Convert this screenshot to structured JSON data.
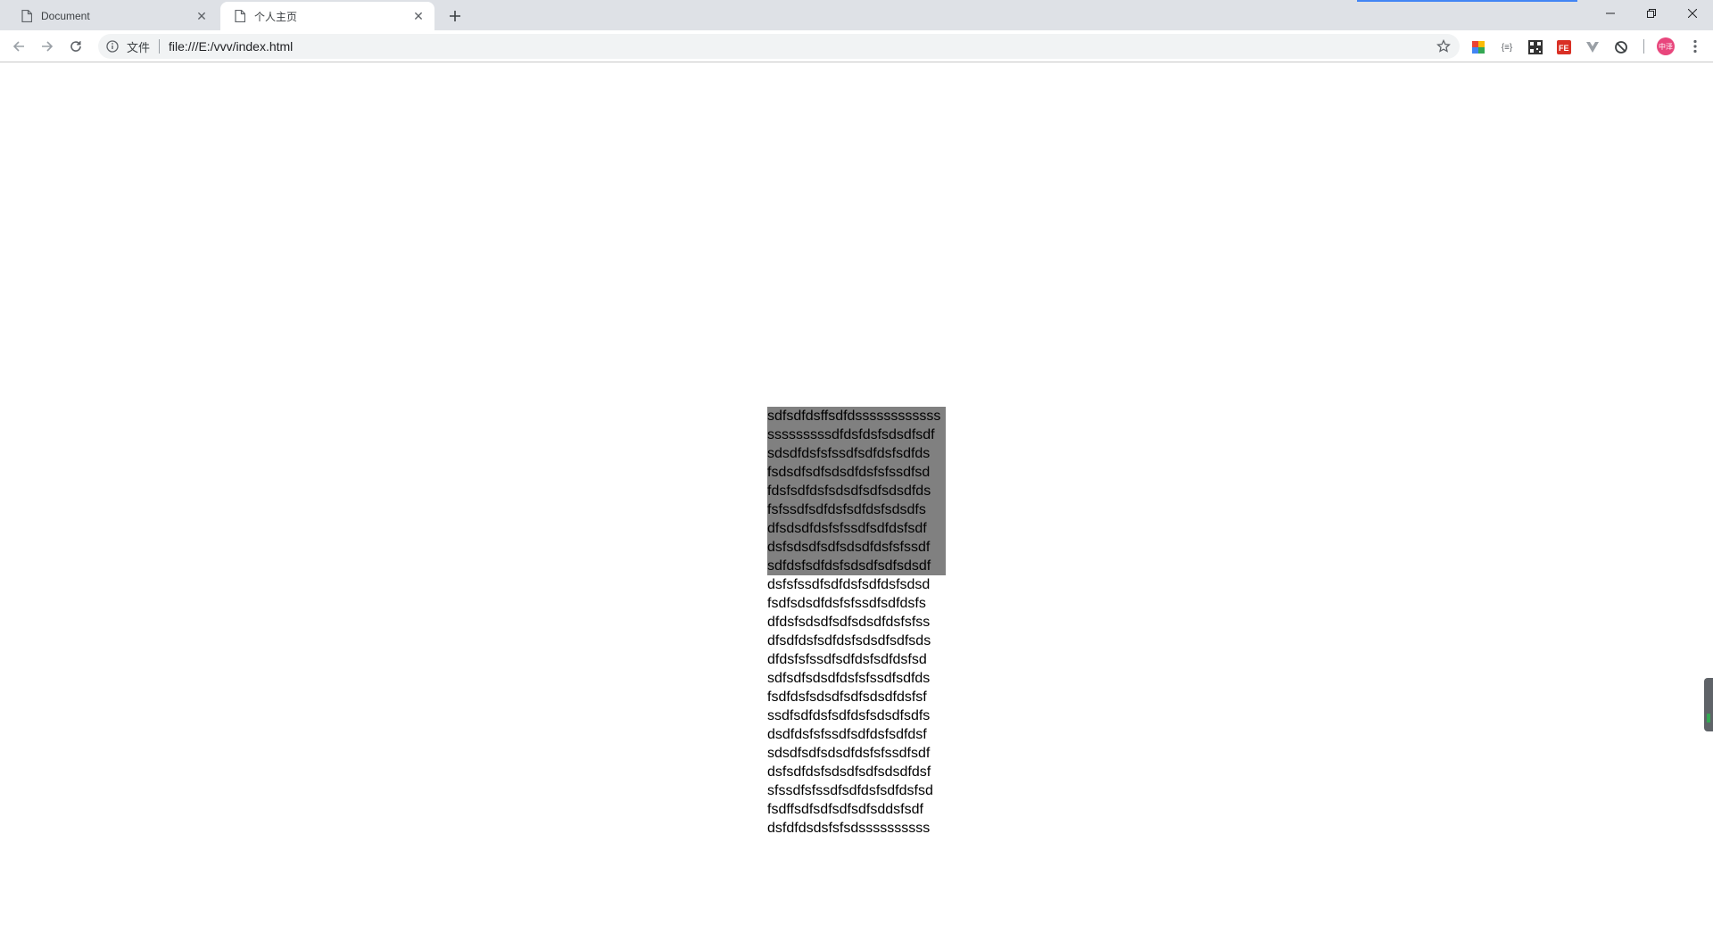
{
  "tabs": [
    {
      "title": "Document",
      "active": false
    },
    {
      "title": "个人主页",
      "active": true
    }
  ],
  "toolbar": {
    "security_chip": "文件",
    "url": "file:///E:/vvv/index.html"
  },
  "icons": {
    "back": "arrow-left-icon",
    "forward": "arrow-right-icon",
    "reload": "reload-icon",
    "info": "info-icon",
    "star": "star-icon",
    "menu": "more-vert-icon"
  },
  "extensions": [
    "google-extension",
    "json-viewer",
    "qr-code",
    "fe-helper",
    "vue-devtools",
    "sync-extension"
  ],
  "profile": {
    "label": "中泽"
  },
  "content": {
    "highlighted_lines": [
      "sdfsdfdsffsdfdssssssssssss",
      "sssssssssdfdsfdsfsdsdfsdf",
      "sdsdfdsfsfssdfsdfdsfsdfds",
      "fsdsdfsdfsdsdfdsfsfssdfsd",
      "fdsfsdfdsfsdsdfsdfsdsdfds",
      "fsfssdfsdfdsfsdfdsfsdsdfs",
      "dfsdsdfdsfsfssdfsdfdsfsdf",
      "dsfsdsdfsdfsdsdfdsfsfssdf",
      "sdfdsfsdfdsfsdsdfsdfsdsdf"
    ],
    "plain_lines": [
      "dsfsfssdfsdfdsfsdfdsfsdsd",
      "fsdfsdsdfdsfsfssdfsdfdsfs",
      "dfdsfsdsdfsdfsdsdfdsfsfss",
      "dfsdfdsfsdfdsfsdsdfsdfsds",
      "dfdsfsfssdfsdfdsfsdfdsfsd",
      "sdfsdfsdsdfdsfsfssdfsdfds",
      "fsdfdsfsdsdfsdfsdsdfdsfsf",
      "ssdfsdfdsfsdfdsfsdsdfsdfs",
      "dsdfdsfsfssdfsdfdsfsdfdsf",
      "sdsdfsdfsdsdfdsfsfssdfsdf",
      "dsfsdfdsfsdsdfsdfsdsdfdsf",
      "sfssdfsfssdfsdfdsfsdfdsfsd",
      "fsdffsdfsdfsdfsdfsddsfsdf",
      "dsfdfdsdsfsfsdssssssssss"
    ]
  },
  "colors": {
    "tabstrip": "#dee1e6",
    "highlight": "#808080",
    "loading_bar": "#4285f4"
  }
}
